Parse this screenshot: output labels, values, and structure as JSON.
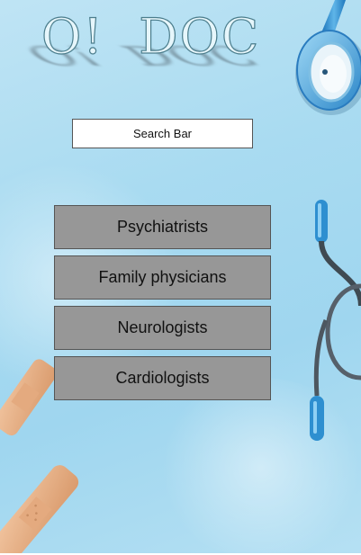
{
  "app": {
    "logo_text": "O!  DOC"
  },
  "search": {
    "label": "Search Bar"
  },
  "categories": [
    {
      "label": "Psychiatrists"
    },
    {
      "label": "Family physicians"
    },
    {
      "label": "Neurologists"
    },
    {
      "label": "Cardiologists"
    }
  ],
  "colors": {
    "background": "#a9dbf1",
    "button_fill": "#979797",
    "stethoscope": "#2e8fd0",
    "bandage": "#e8b58d"
  },
  "decor_icons": [
    "stethoscope-icon",
    "bandage-icon"
  ]
}
